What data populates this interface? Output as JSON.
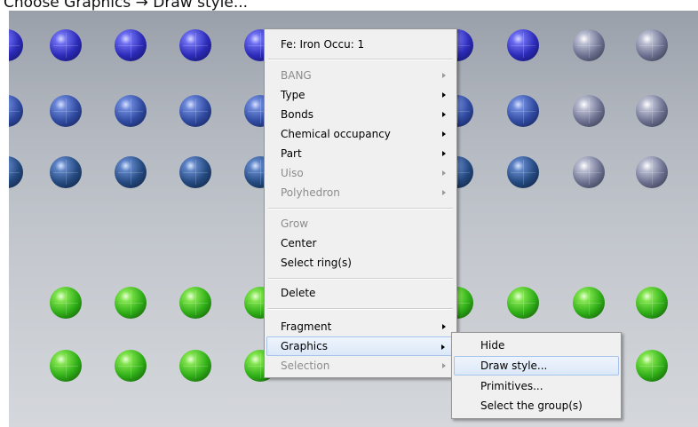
{
  "caption": "Choose Graphics → Draw style...",
  "context_menu": {
    "header": "Fe: Iron Occu: 1",
    "items": [
      {
        "label": "BANG",
        "disabled": true,
        "submenu": true
      },
      {
        "label": "Type",
        "disabled": false,
        "submenu": true
      },
      {
        "label": "Bonds",
        "disabled": false,
        "submenu": true
      },
      {
        "label": "Chemical occupancy",
        "disabled": false,
        "submenu": true
      },
      {
        "label": "Part",
        "disabled": false,
        "submenu": true
      },
      {
        "label": "Uiso",
        "disabled": true,
        "submenu": true
      },
      {
        "label": "Polyhedron",
        "disabled": true,
        "submenu": true
      },
      {
        "label": "Grow",
        "disabled": true,
        "submenu": false
      },
      {
        "label": "Center",
        "disabled": false,
        "submenu": false
      },
      {
        "label": "Select ring(s)",
        "disabled": false,
        "submenu": false
      },
      {
        "label": "Delete",
        "disabled": false,
        "submenu": false
      },
      {
        "label": "Fragment",
        "disabled": false,
        "submenu": true
      },
      {
        "label": "Graphics",
        "disabled": false,
        "submenu": true,
        "highlighted": true
      },
      {
        "label": "Selection",
        "disabled": true,
        "submenu": true
      }
    ]
  },
  "graphics_submenu": {
    "items": [
      {
        "label": "Hide"
      },
      {
        "label": "Draw style...",
        "highlighted": true
      },
      {
        "label": "Primitives..."
      },
      {
        "label": "Select the group(s)"
      }
    ]
  },
  "colors": {
    "menu_bg": "#f0f0f0",
    "highlight_border": "#a8c4ea",
    "disabled_text": "#8c8c8c"
  }
}
